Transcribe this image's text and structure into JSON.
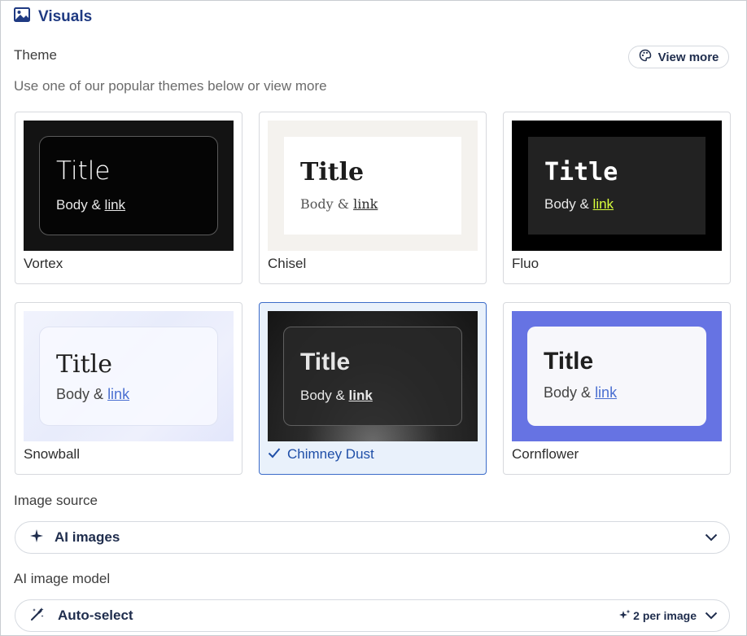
{
  "header": {
    "title": "Visuals",
    "icon": "image-icon"
  },
  "theme": {
    "label": "Theme",
    "subtitle": "Use one of our popular themes below or view more",
    "view_more_label": "View more",
    "view_more_icon": "palette-icon",
    "cards": [
      {
        "name": "Vortex",
        "title": "Title",
        "body": "Body &",
        "link": "link",
        "selected": false
      },
      {
        "name": "Chisel",
        "title": "Title",
        "body": "Body &",
        "link": "link",
        "selected": false
      },
      {
        "name": "Fluo",
        "title": "Title",
        "body": "Body &",
        "link": "link",
        "selected": false
      },
      {
        "name": "Snowball",
        "title": "Title",
        "body": "Body &",
        "link": "link",
        "selected": false
      },
      {
        "name": "Chimney Dust",
        "title": "Title",
        "body": "Body &",
        "link": "link",
        "selected": true
      },
      {
        "name": "Cornflower",
        "title": "Title",
        "body": "Body &",
        "link": "link",
        "selected": false
      }
    ]
  },
  "image_source": {
    "label": "Image source",
    "value": "AI images",
    "icon": "sparkle-icon"
  },
  "ai_model": {
    "label": "AI image model",
    "value": "Auto-select",
    "icon": "magic-wand-icon",
    "credits": "2 per image",
    "credits_icon": "sparkles-icon"
  },
  "colors": {
    "accent": "#1f3a82",
    "selected_border": "#3c6cc9",
    "selected_bg": "#e9f1fb",
    "fluo_link": "#d8ff3c",
    "cornflower_bg": "#6673e3",
    "snowball_link": "#4a6fd1"
  }
}
